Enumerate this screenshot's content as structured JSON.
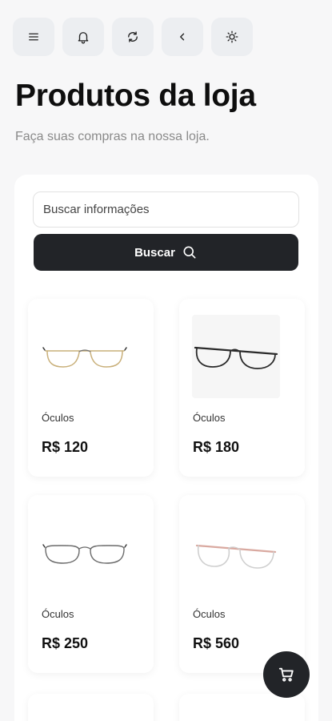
{
  "toolbar": {
    "buttons": [
      {
        "icon": "menu-icon"
      },
      {
        "icon": "bell-icon"
      },
      {
        "icon": "refresh-icon"
      },
      {
        "icon": "back-chevron-icon"
      },
      {
        "icon": "sun-icon"
      }
    ]
  },
  "header": {
    "title": "Produtos da loja",
    "subtitle": "Faça suas compras na nossa loja."
  },
  "search": {
    "placeholder": "Buscar informações",
    "value": "",
    "button_label": "Buscar"
  },
  "products": [
    {
      "name": "Óculos",
      "price": "R$ 120",
      "frame_color": "#c9b07a"
    },
    {
      "name": "Óculos",
      "price": "R$ 180",
      "frame_color": "#2b2b2b"
    },
    {
      "name": "Óculos",
      "price": "R$ 250",
      "frame_color": "#6b6b6b"
    },
    {
      "name": "Óculos",
      "price": "R$ 560",
      "frame_color": "#d9a9a0"
    }
  ],
  "colors": {
    "primary": "#222428",
    "background": "#f7f7f8",
    "icon_button_bg": "#eceef1"
  },
  "cart": {
    "icon": "cart-icon"
  }
}
